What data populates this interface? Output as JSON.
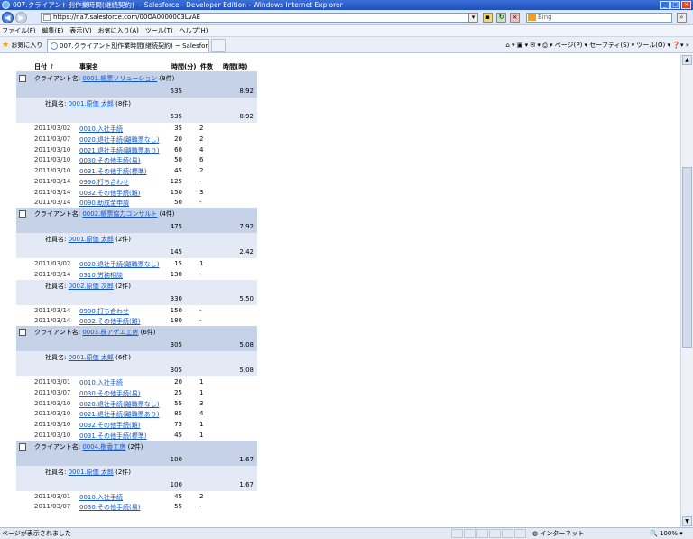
{
  "window": {
    "title": "007.クライアント別作業時間(継続契約) ~ Salesforce - Developer Edition - Windows Internet Explorer",
    "url": "https://na7.salesforce.com/00OA0000003LvAE",
    "search_placeholder": "Bing"
  },
  "menu": [
    "ファイル(F)",
    "編集(E)",
    "表示(V)",
    "お気に入り(A)",
    "ツール(T)",
    "ヘルプ(H)"
  ],
  "favorites_label": "お気に入り",
  "tab_label": "007.クライアント別作業時間(継続契約) ~ Salesforce ...",
  "command_bar": "ページ(P) ▾  セーフティ(S) ▾  ツール(O) ▾",
  "report": {
    "columns": {
      "date": "日付",
      "job": "事案名",
      "minutes": "時間(分)",
      "count": "件数",
      "hours": "時間(時)"
    },
    "client_label": "クライアント名:",
    "staff_label": "社員名:",
    "groups": [
      {
        "client": "0001.帳票ソリューション",
        "client_count": "(8件)",
        "minutes": "535",
        "hours": "8.92",
        "staff": [
          {
            "name": "0001.原価 太郎",
            "count": "(8件)",
            "minutes": "535",
            "hours": "8.92",
            "rows": [
              {
                "date": "2011/03/02",
                "job": "0010.入社手続",
                "min": "35",
                "cnt": "2"
              },
              {
                "date": "2011/03/07",
                "job": "0020.退社手続(離職票なし)",
                "min": "20",
                "cnt": "2"
              },
              {
                "date": "2011/03/10",
                "job": "0021.退社手続(離職票あり)",
                "min": "60",
                "cnt": "4"
              },
              {
                "date": "2011/03/10",
                "job": "0030.その他手続(易)",
                "min": "50",
                "cnt": "6"
              },
              {
                "date": "2011/03/10",
                "job": "0031.その他手続(標準)",
                "min": "45",
                "cnt": "2"
              },
              {
                "date": "2011/03/14",
                "job": "0990.打ち合わせ",
                "min": "125",
                "cnt": "-"
              },
              {
                "date": "2011/03/14",
                "job": "0032.その他手続(難)",
                "min": "150",
                "cnt": "3"
              },
              {
                "date": "2011/03/14",
                "job": "0090.助成金申請",
                "min": "50",
                "cnt": "-"
              }
            ]
          }
        ]
      },
      {
        "client": "0002.帳票協力コンサルト",
        "client_count": "(4件)",
        "minutes": "475",
        "hours": "7.92",
        "staff": [
          {
            "name": "0001.原価 太郎",
            "count": "(2件)",
            "minutes": "145",
            "hours": "2.42",
            "rows": [
              {
                "date": "2011/03/02",
                "job": "0020.退社手続(離職票なし)",
                "min": "15",
                "cnt": "1"
              },
              {
                "date": "2011/03/14",
                "job": "0310.労務相談",
                "min": "130",
                "cnt": "-"
              }
            ]
          },
          {
            "name": "0002.原価 次郎",
            "count": "(2件)",
            "minutes": "330",
            "hours": "5.50",
            "rows": [
              {
                "date": "2011/03/14",
                "job": "0990.打ち合わせ",
                "min": "150",
                "cnt": "-"
              },
              {
                "date": "2011/03/14",
                "job": "0032.その他手続(難)",
                "min": "180",
                "cnt": "-"
              }
            ]
          }
        ]
      },
      {
        "client": "0003.株アゲエ工房",
        "client_count": "(6件)",
        "minutes": "305",
        "hours": "5.08",
        "staff": [
          {
            "name": "0001.原価 太郎",
            "count": "(6件)",
            "minutes": "305",
            "hours": "5.08",
            "rows": [
              {
                "date": "2011/03/01",
                "job": "0010.入社手続",
                "min": "20",
                "cnt": "1"
              },
              {
                "date": "2011/03/07",
                "job": "0030.その他手続(易)",
                "min": "25",
                "cnt": "1"
              },
              {
                "date": "2011/03/10",
                "job": "0020.退社手続(離職票なし)",
                "min": "55",
                "cnt": "3"
              },
              {
                "date": "2011/03/10",
                "job": "0021.退社手続(離職票あり)",
                "min": "85",
                "cnt": "4"
              },
              {
                "date": "2011/03/10",
                "job": "0032.その他手続(難)",
                "min": "75",
                "cnt": "1"
              },
              {
                "date": "2011/03/10",
                "job": "0031.その他手続(標準)",
                "min": "45",
                "cnt": "1"
              }
            ]
          }
        ]
      },
      {
        "client": "0004.樹香工房",
        "client_count": "(2件)",
        "minutes": "100",
        "hours": "1.67",
        "staff": [
          {
            "name": "0001.原価 太郎",
            "count": "(2件)",
            "minutes": "100",
            "hours": "1.67",
            "rows": [
              {
                "date": "2011/03/01",
                "job": "0010.入社手続",
                "min": "45",
                "cnt": "2"
              },
              {
                "date": "2011/03/07",
                "job": "0030.その他手続(易)",
                "min": "55",
                "cnt": "-"
              }
            ]
          }
        ]
      }
    ]
  },
  "status": {
    "message": "ページが表示されました",
    "zone": "インターネット",
    "zoom": "100%"
  }
}
